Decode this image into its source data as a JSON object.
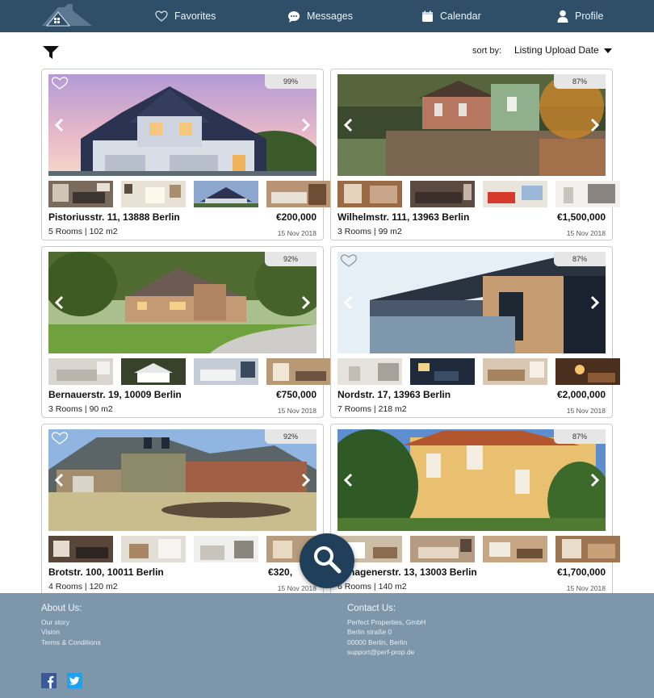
{
  "nav": {
    "items": [
      {
        "label": "Favorites",
        "icon": "heart-outline-icon"
      },
      {
        "label": "Messages",
        "icon": "chat-bubble-icon"
      },
      {
        "label": "Calendar",
        "icon": "calendar-icon"
      },
      {
        "label": "Profile",
        "icon": "user-icon"
      }
    ],
    "logo": "house-logo"
  },
  "toolbar": {
    "filter_icon": "funnel-icon",
    "sort_label": "sort by:",
    "sort_value": "Listing Upload Date"
  },
  "listings": [
    {
      "address": "Pistoriusstr. 11, 13888 Berlin",
      "price": "€200,000",
      "rooms": "5 Rooms | 102 m2",
      "date": "15 Nov 2018",
      "match": "99%"
    },
    {
      "address": "Wilhelmstr. 111, 13963 Berlin",
      "price": "€1,500,000",
      "rooms": "3 Rooms | 99 m2",
      "date": "15 Nov 2018",
      "match": "87%"
    },
    {
      "address": "Bernauerstr. 19, 10009 Berlin",
      "price": "€750,000",
      "rooms": "3 Rooms | 90 m2",
      "date": "15 Nov 2018",
      "match": "92%"
    },
    {
      "address": "Nordstr. 17, 13963 Berlin",
      "price": "€2,000,000",
      "rooms": "7 Rooms | 218 m2",
      "date": "15 Nov 2018",
      "match": "87%"
    },
    {
      "address": "Brotstr. 100, 10011 Berlin",
      "price": "€320,",
      "rooms": "4 Rooms | 120 m2",
      "date": "15 Nov 2018",
      "match": "92%"
    },
    {
      "address": "enhagenerstr. 13, 13003 Berlin",
      "price": "€1,700,000",
      "rooms": "6 Rooms | 140 m2",
      "date": "15 Nov 2018",
      "match": "87%"
    }
  ],
  "footer": {
    "about": {
      "title": "About Us:",
      "links": [
        "Our story",
        "Vision",
        "Terms & Conditions"
      ]
    },
    "contact": {
      "title": "Contact Us:",
      "lines": [
        "Perfect Properties, GmbH",
        "Berlin straße 0",
        "00000 Berlin, Berlin",
        "support@perf-prop.de"
      ]
    },
    "social": [
      "facebook-icon",
      "twitter-icon"
    ]
  },
  "colors": {
    "nav_bg": "#2f4f68",
    "footer_bg": "#7d96aa",
    "fab_bg": "#1f3f5a"
  }
}
